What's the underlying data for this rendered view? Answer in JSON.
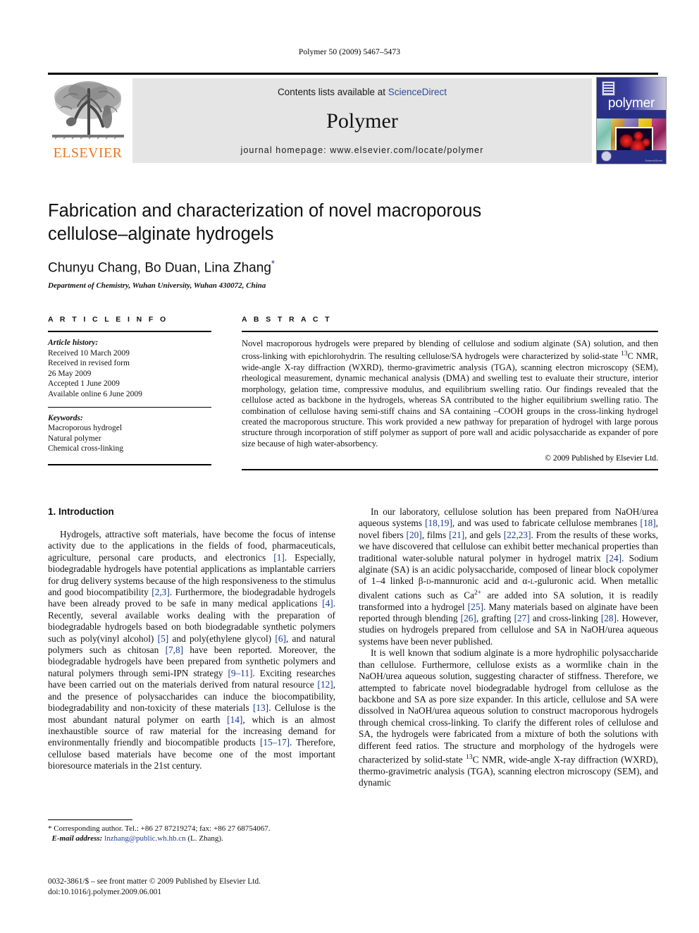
{
  "running_head": "Polymer 50 (2009) 5467–5473",
  "masthead": {
    "publisher_name": "ELSEVIER",
    "contents_prefix": "Contents lists available at ",
    "contents_link": "ScienceDirect",
    "journal_title": "Polymer",
    "homepage": "journal homepage: www.elsevier.com/locate/polymer",
    "cover_word": "polymer",
    "link_color": "#2b4d9e",
    "panel_color": "#e5e5e5",
    "elsevier_orange": "#e87722",
    "cover_blue": "#2a2f86"
  },
  "article": {
    "title": "Fabrication and characterization of novel macroporous cellulose–alginate hydrogels",
    "authors": "Chunyu Chang, Bo Duan, Lina Zhang",
    "corresponding_mark": "*",
    "affiliation": "Department of Chemistry, Wuhan University, Wuhan 430072, China"
  },
  "article_info": {
    "heading": "A R T I C L E   I N F O",
    "history_label": "Article history:",
    "history": [
      "Received 10 March 2009",
      "Received in revised form",
      "26 May 2009",
      "Accepted 1 June 2009",
      "Available online 6 June 2009"
    ],
    "keywords_label": "Keywords:",
    "keywords": [
      "Macroporous hydrogel",
      "Natural polymer",
      "Chemical cross-linking"
    ]
  },
  "abstract": {
    "heading": "A B S T R A C T",
    "text": "Novel macroporous hydrogels were prepared by blending of cellulose and sodium alginate (SA) solution, and then cross-linking with epichlorohydrin. The resulting cellulose/SA hydrogels were characterized by solid-state 13C NMR, wide-angle X-ray diffraction (WXRD), thermo-gravimetric analysis (TGA), scanning electron microscopy (SEM), rheological measurement, dynamic mechanical analysis (DMA) and swelling test to evaluate their structure, interior morphology, gelation time, compressive modulus, and equilibrium swelling ratio. Our findings revealed that the cellulose acted as backbone in the hydrogels, whereas SA contributed to the higher equilibrium swelling ratio. The combination of cellulose having semi-stiff chains and SA containing –COOH groups in the cross-linking hydrogel created the macroporous structure. This work provided a new pathway for preparation of hydrogel with large porous structure through incorporation of stiff polymer as support of pore wall and acidic polysaccharide as expander of pore size because of high water-absorbency.",
    "copyright": "© 2009 Published by Elsevier Ltd."
  },
  "body": {
    "intro_heading": "1. Introduction",
    "left_paragraph_1": "Hydrogels, attractive soft materials, have become the focus of intense activity due to the applications in the fields of food, pharmaceuticals, agriculture, personal care products, and electronics [1]. Especially, biodegradable hydrogels have potential applications as implantable carriers for drug delivery systems because of the high responsiveness to the stimulus and good biocompatibility [2,3]. Furthermore, the biodegradable hydrogels have been already proved to be safe in many medical applications [4]. Recently, several available works dealing with the preparation of biodegradable hydrogels based on both biodegradable synthetic polymers such as poly(vinyl alcohol) [5] and poly(ethylene glycol) [6], and natural polymers such as chitosan [7,8] have been reported. Moreover, the biodegradable hydrogels have been prepared from synthetic polymers and natural polymers through semi-IPN strategy [9–11]. Exciting researches have been carried out on the materials derived from natural resource [12], and the presence of polysaccharides can induce the biocompatibility, biodegradability and non-toxicity of these materials [13]. Cellulose is the most abundant natural polymer on earth [14], which is an almost inexhaustible source of raw material for the increasing demand for environmentally friendly and biocompatible products [15–17]. Therefore, cellulose based materials have become one of the most important bioresource materials in the 21st century.",
    "right_paragraph_1": "In our laboratory, cellulose solution has been prepared from NaOH/urea aqueous systems [18,19], and was used to fabricate cellulose membranes [18], novel fibers [20], films [21], and gels [22,23]. From the results of these works, we have discovered that cellulose can exhibit better mechanical properties than traditional water-soluble natural polymer in hydrogel matrix [24]. Sodium alginate (SA) is an acidic polysaccharide, composed of linear block copolymer of 1–4 linked β-D-mannuronic acid and α-L-guluronic acid. When metallic divalent cations such as Ca2+ are added into SA solution, it is readily transformed into a hydrogel [25]. Many materials based on alginate have been reported through blending [26], grafting [27] and cross-linking [28]. However, studies on hydrogels prepared from cellulose and SA in NaOH/urea aqueous systems have been never published.",
    "right_paragraph_2": "It is well known that sodium alginate is a more hydrophilic polysaccharide than cellulose. Furthermore, cellulose exists as a wormlike chain in the NaOH/urea aqueous solution, suggesting character of stiffness. Therefore, we attempted to fabricate novel biodegradable hydrogel from cellulose as the backbone and SA as pore size expander. In this article, cellulose and SA were dissolved in NaOH/urea aqueous solution to construct macroporous hydrogels through chemical cross-linking. To clarify the different roles of cellulose and SA, the hydrogels were fabricated from a mixture of both the solutions with different feed ratios. The structure and morphology of the hydrogels were characterized by solid-state 13C NMR, wide-angle X-ray diffraction (WXRD), thermo-gravimetric analysis (TGA), scanning electron microscopy (SEM), and dynamic"
  },
  "footnote": {
    "corresponding": "* Corresponding author. Tel.: +86 27 87219274; fax: +86 27 68754067.",
    "email_label": "E-mail address:",
    "email": "lnzhang@public.wh.hb.cn",
    "email_suffix": "(L. Zhang)."
  },
  "imprint": {
    "line1": "0032-3861/$ – see front matter © 2009 Published by Elsevier Ltd.",
    "line2": "doi:10.1016/j.polymer.2009.06.001"
  }
}
